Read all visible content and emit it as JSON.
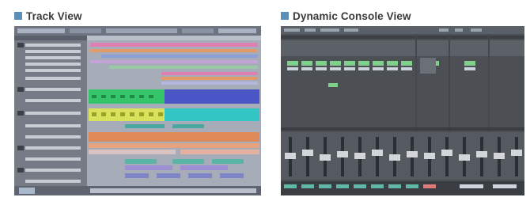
{
  "panels": [
    {
      "title": "Track View"
    },
    {
      "title": "Dynamic Console View"
    }
  ],
  "colors": {
    "heading_square": "#5b8fb9",
    "heading_text": "#3a3a3a",
    "track_bg": "#8d9198",
    "track_green": "#35c46a",
    "track_yellow": "#d9e25a",
    "track_blue": "#4a56c6",
    "track_cyan": "#33c4c4",
    "track_orange": "#e08a5a",
    "track_pink": "#e07fb3",
    "console_bg": "#4c5055",
    "console_green": "#7fd08a"
  }
}
